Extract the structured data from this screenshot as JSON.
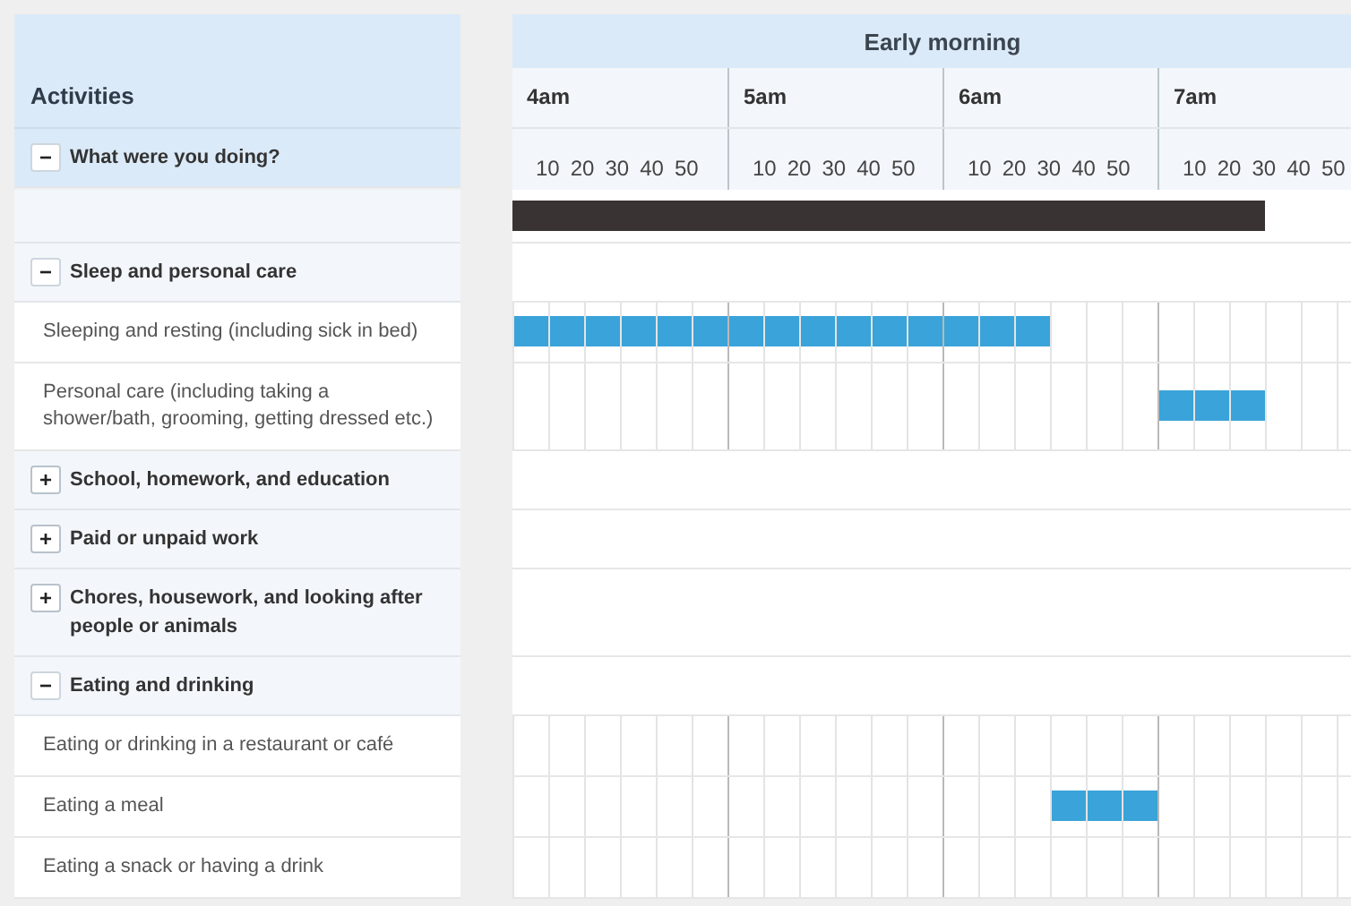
{
  "activities_header": "Activities",
  "period": "Early morning",
  "hours": [
    {
      "label": "4am",
      "ticks": [
        "10",
        "20",
        "30",
        "40",
        "50"
      ]
    },
    {
      "label": "5am",
      "ticks": [
        "10",
        "20",
        "30",
        "40",
        "50"
      ]
    },
    {
      "label": "6am",
      "ticks": [
        "10",
        "20",
        "30",
        "40",
        "50"
      ]
    },
    {
      "label": "7am",
      "ticks": [
        "10",
        "20",
        "30",
        "40",
        "50"
      ]
    }
  ],
  "question": {
    "label": "What were you doing?",
    "toggle": "−",
    "expanded": true
  },
  "day_bar": {
    "level": 0.875
  },
  "sections": [
    {
      "label": "Sleep and personal care",
      "toggle": "−",
      "expanded": true,
      "children": [
        {
          "label": "Sleeping and resting (including sick in bed)",
          "slots": [
            true,
            true,
            true,
            true,
            true,
            true,
            true,
            true,
            true,
            true,
            true,
            true,
            true,
            true,
            true,
            false,
            false,
            false,
            false,
            false,
            false,
            false,
            false,
            false
          ]
        },
        {
          "label": "Personal care (including taking a shower/bath, grooming, getting dressed etc.)",
          "slots": [
            false,
            false,
            false,
            false,
            false,
            false,
            false,
            false,
            false,
            false,
            false,
            false,
            false,
            false,
            false,
            false,
            false,
            false,
            true,
            true,
            true,
            false,
            false,
            false
          ]
        }
      ]
    },
    {
      "label": "School, homework, and education",
      "toggle": "+",
      "expanded": false
    },
    {
      "label": "Paid or unpaid work",
      "toggle": "+",
      "expanded": false
    },
    {
      "label": "Chores, housework, and looking after people or animals",
      "toggle": "+",
      "expanded": false
    },
    {
      "label": "Eating and drinking",
      "toggle": "−",
      "expanded": true,
      "children": [
        {
          "label": "Eating or drinking in a restaurant or café",
          "slots": [
            false,
            false,
            false,
            false,
            false,
            false,
            false,
            false,
            false,
            false,
            false,
            false,
            false,
            false,
            false,
            false,
            false,
            false,
            false,
            false,
            false,
            false,
            false,
            false
          ]
        },
        {
          "label": "Eating a meal",
          "slots": [
            false,
            false,
            false,
            false,
            false,
            false,
            false,
            false,
            false,
            false,
            false,
            false,
            false,
            false,
            false,
            true,
            true,
            true,
            false,
            false,
            false,
            false,
            false,
            false
          ]
        },
        {
          "label": "Eating a snack or having a drink",
          "slots": [
            false,
            false,
            false,
            false,
            false,
            false,
            false,
            false,
            false,
            false,
            false,
            false,
            false,
            false,
            false,
            false,
            false,
            false,
            false,
            false,
            false,
            false,
            false,
            false
          ]
        }
      ]
    }
  ]
}
